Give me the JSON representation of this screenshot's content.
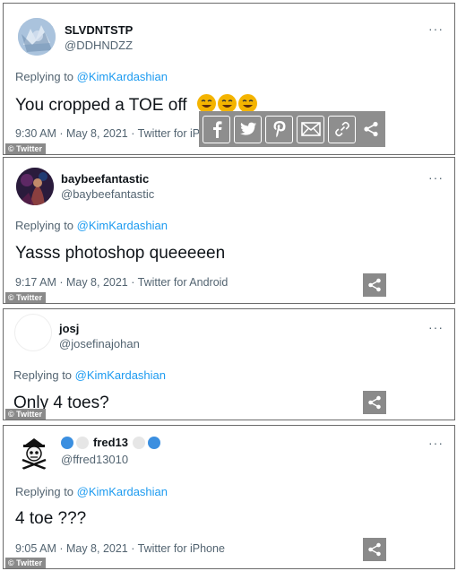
{
  "tweets": [
    {
      "name": "SLVDNTSTP",
      "handle": "@DDHNDZZ",
      "replying_prefix": "Replying to ",
      "replying_to": "@KimKardashian",
      "text": "You cropped a TOE off",
      "emoji": "🤣🤣🤣",
      "meta": "9:30 AM · May 8, 2021 · Twitter for iPhone",
      "more": "···",
      "badge": "© Twitter"
    },
    {
      "name": "baybeefantastic",
      "handle": "@baybeefantastic",
      "replying_prefix": "Replying to ",
      "replying_to": "@KimKardashian",
      "text": "Yasss photoshop queeeeen",
      "meta": "9:17 AM · May 8, 2021 · Twitter for Android",
      "more": "···",
      "badge": "© Twitter"
    },
    {
      "name": "josj",
      "handle": "@josefinajohan",
      "replying_prefix": "Replying to ",
      "replying_to": "@KimKardashian",
      "text": "Only 4 toes?",
      "more": "···",
      "badge": "© Twitter"
    },
    {
      "name": "fred13",
      "handle": "@ffred13010",
      "replying_prefix": "Replying to ",
      "replying_to": "@KimKardashian",
      "text": "4 toe ???",
      "meta": "9:05 AM · May 8, 2021 · Twitter for iPhone",
      "more": "···",
      "badge": "© Twitter"
    }
  ],
  "share_icons": [
    "facebook-icon",
    "twitter-icon",
    "pinterest-icon",
    "email-icon",
    "link-icon",
    "share-icon"
  ],
  "colors": {
    "link": "#1d9bf0",
    "secondary": "#536471",
    "badge": "#8a8a8a"
  }
}
